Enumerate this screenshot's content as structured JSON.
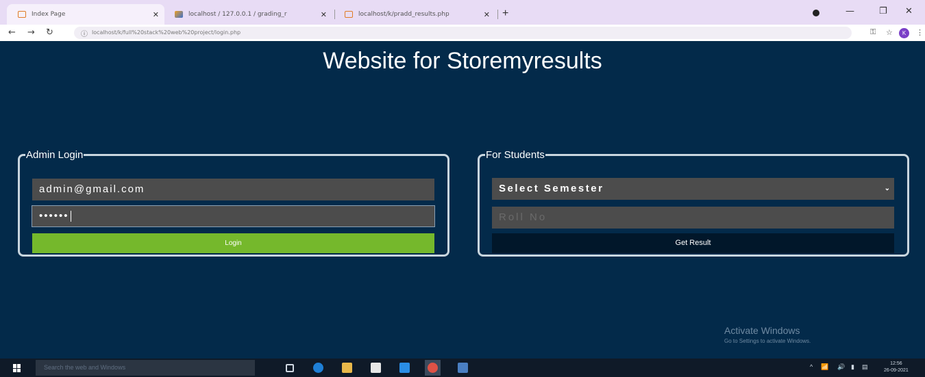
{
  "browser": {
    "tabs": [
      {
        "title": "Index Page",
        "active": true
      },
      {
        "title": "localhost / 127.0.0.1 / grading_r"
      },
      {
        "title": "localhost/k/pradd_results.php"
      }
    ],
    "url": "localhost/k/full%20stack%20web%20project/login.php",
    "profile_initial": "K"
  },
  "page": {
    "title": "Website for Storemyresults",
    "admin": {
      "legend": "Admin Login",
      "email_value": "admin@gmail.com",
      "password_mask": "••••••",
      "login_label": "Login"
    },
    "students": {
      "legend": "For Students",
      "semester_selected": "Select Semester",
      "roll_placeholder": "Roll No",
      "result_label": "Get Result"
    },
    "watermark": {
      "line1": "Activate Windows",
      "line2": "Go to Settings to activate Windows."
    }
  },
  "taskbar": {
    "search_placeholder": "Search the web and Windows",
    "time": "12:56",
    "date": "26-09-2021"
  },
  "colors": {
    "page_bg": "#032a4a",
    "login_button": "#75b82c",
    "result_button": "#01172a",
    "input_bg": "#4c4c4c"
  }
}
